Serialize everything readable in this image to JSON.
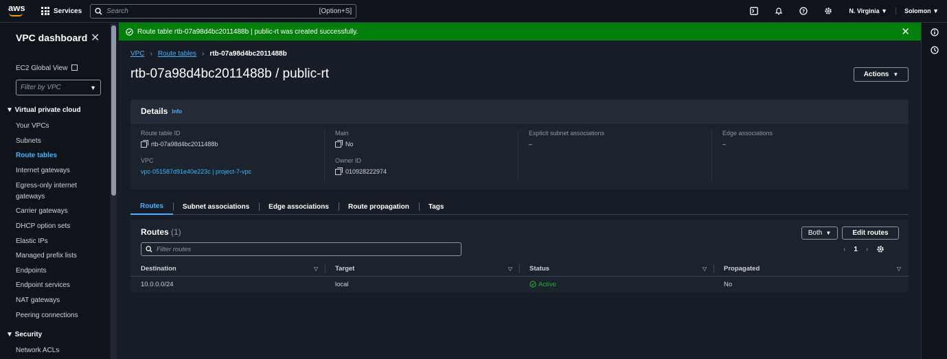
{
  "topbar": {
    "logo_text": "aws",
    "services_label": "Services",
    "search_placeholder": "Search",
    "search_shortcut": "[Option+S]",
    "region": "N. Virginia ▼",
    "user": "Solomon ▼"
  },
  "sidebar": {
    "title": "VPC dashboard",
    "ec2_global_view": "EC2 Global View",
    "filter_placeholder": "Filter by VPC",
    "sections": [
      {
        "label": "▼ Virtual private cloud",
        "items": [
          "Your VPCs",
          "Subnets",
          "Route tables",
          "Internet gateways",
          "Egress-only internet gateways",
          "Carrier gateways",
          "DHCP option sets",
          "Elastic IPs",
          "Managed prefix lists",
          "Endpoints",
          "Endpoint services",
          "NAT gateways",
          "Peering connections"
        ]
      },
      {
        "label": "▼ Security",
        "items": [
          "Network ACLs"
        ]
      }
    ],
    "active_item": "Route tables"
  },
  "flash": {
    "message": "Route table rtb-07a98d4bc2011488b | public-rt was created successfully.",
    "color": "#037f0c"
  },
  "breadcrumb": {
    "items": [
      "VPC",
      "Route tables"
    ],
    "current": "rtb-07a98d4bc2011488b"
  },
  "page": {
    "title": "rtb-07a98d4bc2011488b / public-rt",
    "actions_label": "Actions"
  },
  "details": {
    "header": "Details",
    "info": "Info",
    "fields": {
      "route_table_id_label": "Route table ID",
      "route_table_id": "rtb-07a98d4bc2011488b",
      "main_label": "Main",
      "main": "No",
      "explicit_label": "Explicit subnet associations",
      "explicit": "–",
      "edge_label": "Edge associations",
      "edge": "–",
      "vpc_label": "VPC",
      "vpc": "vpc-051587d91e40e223c | project-7-vpc",
      "owner_label": "Owner ID",
      "owner": "010928222974"
    }
  },
  "tabs": [
    "Routes",
    "Subnet associations",
    "Edge associations",
    "Route propagation",
    "Tags"
  ],
  "routes": {
    "title": "Routes",
    "count": "(1)",
    "filter_placeholder": "Filter routes",
    "both_label": "Both",
    "edit_label": "Edit routes",
    "page": "1",
    "columns": [
      "Destination",
      "Target",
      "Status",
      "Propagated"
    ],
    "rows": [
      {
        "destination": "10.0.0.0/24",
        "target": "local",
        "status": "Active",
        "propagated": "No"
      }
    ]
  },
  "colors": {
    "accent": "#42b4ff",
    "success": "#29ad32",
    "banner": "#037f0c"
  }
}
